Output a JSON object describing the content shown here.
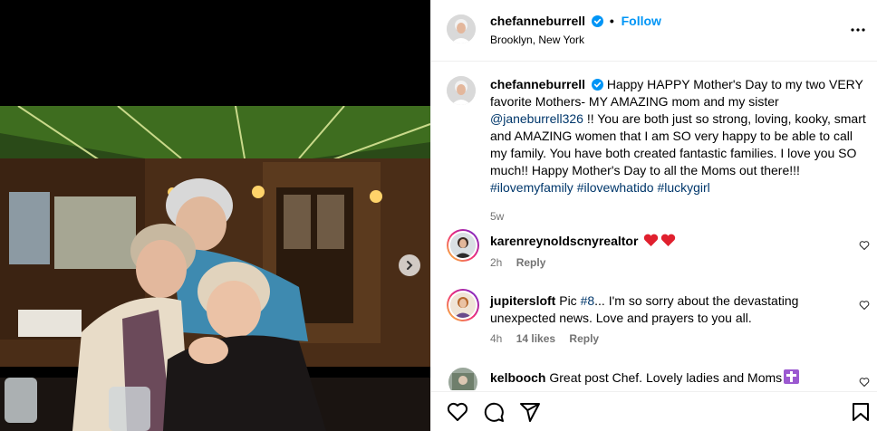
{
  "post": {
    "author": "chefanneburrell",
    "follow_label": "Follow",
    "separator": "•",
    "location": "Brooklyn, New York"
  },
  "caption": {
    "username": "chefanneburrell",
    "text_1": "Happy HAPPY Mother's Day to my two VERY favorite Mothers- MY AMAZING mom and my sister ",
    "mention": "@janeburrell326",
    "text_2": " !! You are both just so strong, loving, kooky, smart and AMAZING women that I am SO very happy to be able to call my family. You have both created fantastic families. I love you SO much!! Happy Mother's Day to all the Moms out there!!! ",
    "hashtags": [
      "#ilovemyfamily",
      "#ilovewhatido",
      "#luckygirl"
    ],
    "time": "5w"
  },
  "comments": [
    {
      "username": "karenreynoldscnyrealtor",
      "text": "",
      "emoji": [
        "red-heart",
        "red-heart"
      ],
      "time": "2h",
      "likes": "",
      "reply": "Reply"
    },
    {
      "username": "jupitersloft",
      "text_pre": "Pic ",
      "link": "#8",
      "text_post": "... I'm so sorry about the devastating unexpected news. Love and prayers to you all.",
      "time": "4h",
      "likes": "14 likes",
      "reply": "Reply"
    },
    {
      "username": "kelbooch",
      "text": "Great post Chef. Lovely ladies and Moms",
      "emoji": [
        "latin-cross"
      ]
    }
  ],
  "icons": {
    "more": "more-horizontal-icon",
    "next": "chevron-right-icon",
    "like": "heart-icon",
    "comment": "comment-icon",
    "share": "share-icon",
    "save": "bookmark-icon"
  },
  "colors": {
    "follow": "#0095f6",
    "link": "#00376b",
    "muted": "#737373",
    "verified": "#0095f6"
  }
}
